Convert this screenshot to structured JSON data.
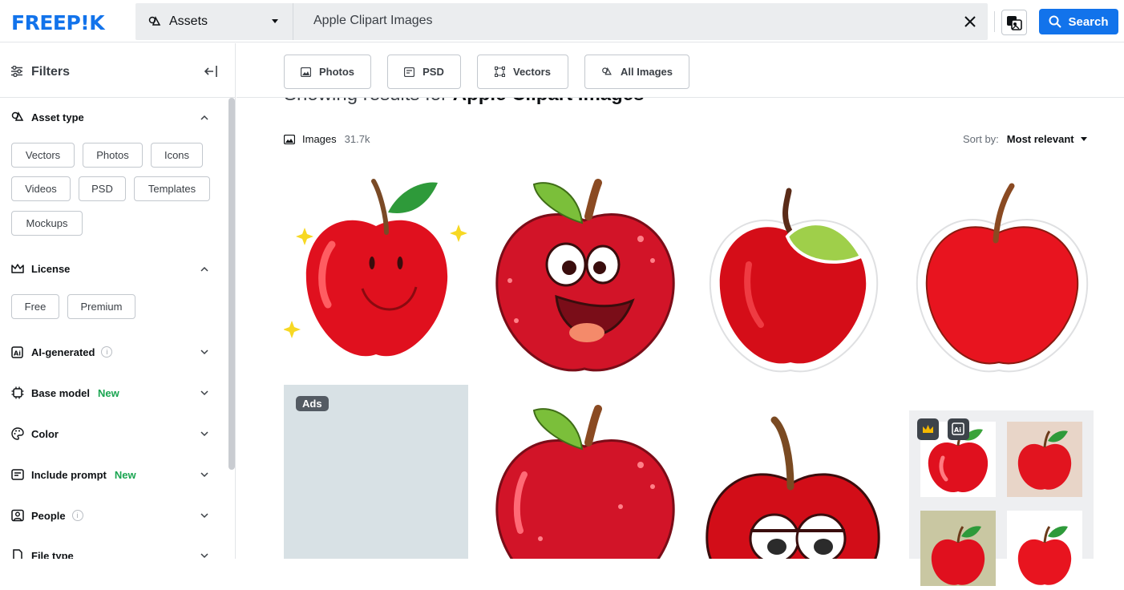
{
  "header": {
    "logo": "FREEP!K",
    "asset_select": "Assets",
    "search_value": "Apple Clipart Images",
    "search_button": "Search"
  },
  "sidebar": {
    "title": "Filters",
    "asset_type": {
      "label": "Asset type",
      "chips": [
        "Vectors",
        "Photos",
        "Icons",
        "Videos",
        "PSD",
        "Templates",
        "Mockups"
      ]
    },
    "license": {
      "label": "License",
      "chips": [
        "Free",
        "Premium"
      ]
    },
    "sections": {
      "ai_generated": "AI-generated",
      "base_model": "Base model",
      "color": "Color",
      "include_prompt": "Include prompt",
      "people": "People",
      "file_type": "File type"
    },
    "new_badge": "New",
    "info_glyph": "i"
  },
  "tabs": [
    "Photos",
    "PSD",
    "Vectors",
    "All Images"
  ],
  "results": {
    "showing_prefix": "Showing results for",
    "query": "Apple Clipart Images",
    "images_label": "Images",
    "images_count": "31.7k",
    "sort_label": "Sort by:",
    "sort_value": "Most relevant",
    "ads_label": "Ads"
  },
  "colors": {
    "brand": "#1273eb",
    "new": "#1aa551",
    "apple_red": "#e0101e",
    "leaf_green": "#2e9a3a"
  }
}
